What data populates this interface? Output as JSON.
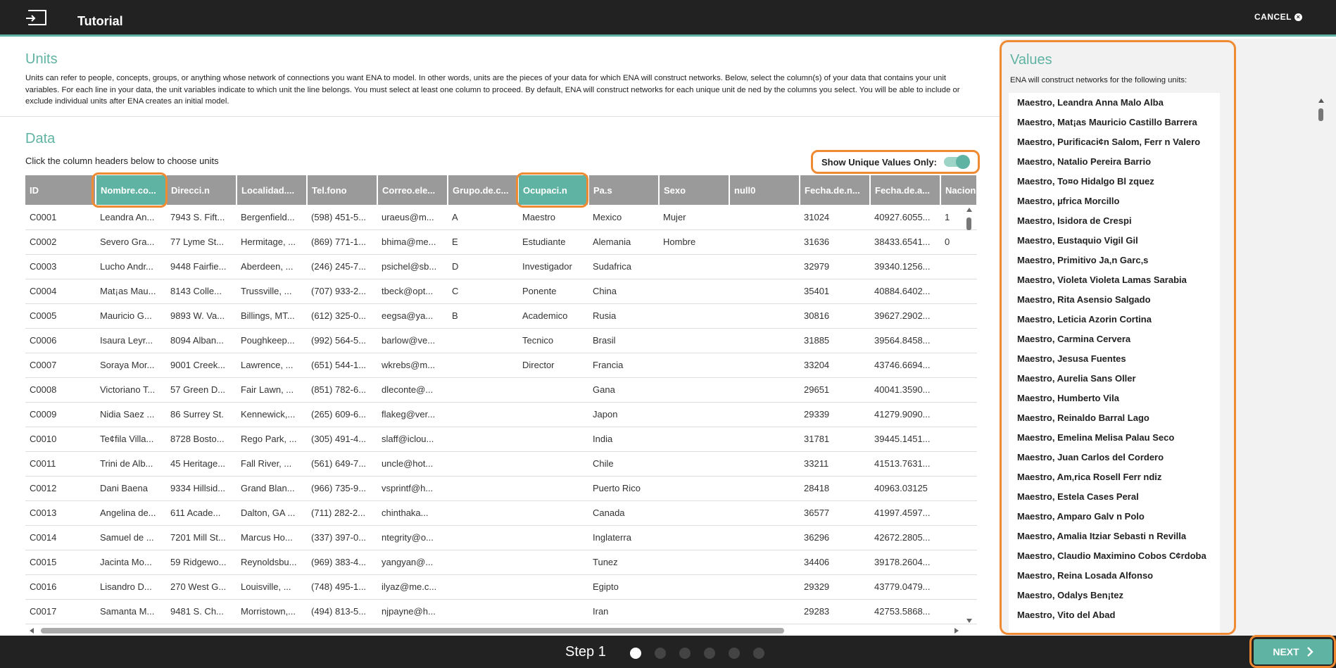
{
  "header": {
    "title": "Tutorial",
    "cancel_label": "CANCEL"
  },
  "units": {
    "title": "Units",
    "description": "Units can refer to people, concepts, groups, or anything whose network of connections you want ENA to model. In other words, units are the pieces of your data for which ENA will construct networks. Below, select the column(s) of your data that contains your unit variables. For each line in your data, the unit variables indicate to which unit the line belongs. You must select at least one column to proceed. By default, ENA will construct networks for each unique unit de ned by the columns you select. You will be able to include or exclude individual units after ENA creates an initial model."
  },
  "data": {
    "title": "Data",
    "hint": "Click the column headers below to choose units",
    "toggle_label": "Show Unique Values Only:",
    "toggle_on": true,
    "columns": [
      {
        "label": "ID",
        "selected": false
      },
      {
        "label": "Nombre.co...",
        "selected": true
      },
      {
        "label": "Direcci.n",
        "selected": false
      },
      {
        "label": "Localidad....",
        "selected": false
      },
      {
        "label": "Tel.fono",
        "selected": false
      },
      {
        "label": "Correo.ele...",
        "selected": false
      },
      {
        "label": "Grupo.de.c...",
        "selected": false
      },
      {
        "label": "Ocupaci.n",
        "selected": true
      },
      {
        "label": "Pa.s",
        "selected": false
      },
      {
        "label": "Sexo",
        "selected": false
      },
      {
        "label": "null0",
        "selected": false
      },
      {
        "label": "Fecha.de.n...",
        "selected": false
      },
      {
        "label": "Fecha.de.a...",
        "selected": false
      },
      {
        "label": "Nacion",
        "selected": false
      }
    ],
    "rows": [
      [
        "C0001",
        "Leandra An...",
        "7943 S. Fift...",
        "Bergenfield...",
        "(598) 451-5...",
        "uraeus@m...",
        "A",
        "Maestro",
        "Mexico",
        "Mujer",
        "",
        "31024",
        "40927.6055...",
        "1"
      ],
      [
        "C0002",
        "Severo Gra...",
        "77 Lyme St...",
        "Hermitage, ...",
        "(869) 771-1...",
        "bhima@me...",
        "E",
        "Estudiante",
        "Alemania",
        "Hombre",
        "",
        "31636",
        "38433.6541...",
        "0"
      ],
      [
        "C0003",
        "Lucho Andr...",
        "9448 Fairfie...",
        "Aberdeen, ...",
        "(246) 245-7...",
        "psichel@sb...",
        "D",
        "Investigador",
        "Sudafrica",
        "",
        "",
        "32979",
        "39340.1256...",
        ""
      ],
      [
        "C0004",
        "Mat¡as Mau...",
        "8143 Colle...",
        "Trussville, ...",
        "(707) 933-2...",
        "tbeck@opt...",
        "C",
        "Ponente",
        "China",
        "",
        "",
        "35401",
        "40884.6402...",
        ""
      ],
      [
        "C0005",
        "Mauricio G...",
        "9893 W. Va...",
        "Billings, MT...",
        "(612) 325-0...",
        "eegsa@ya...",
        "B",
        "Academico",
        "Rusia",
        "",
        "",
        "30816",
        "39627.2902...",
        ""
      ],
      [
        "C0006",
        "Isaura Leyr...",
        "8094 Alban...",
        "Poughkeep...",
        "(992) 564-5...",
        "barlow@ve...",
        "",
        "Tecnico",
        "Brasil",
        "",
        "",
        "31885",
        "39564.8458...",
        ""
      ],
      [
        "C0007",
        "Soraya Mor...",
        "9001 Creek...",
        "Lawrence, ...",
        "(651) 544-1...",
        "wkrebs@m...",
        "",
        "Director",
        "Francia",
        "",
        "",
        "33204",
        "43746.6694...",
        ""
      ],
      [
        "C0008",
        "Victoriano T...",
        "57 Green D...",
        "Fair Lawn, ...",
        "(851) 782-6...",
        "dleconte@...",
        "",
        "",
        "Gana",
        "",
        "",
        "29651",
        "40041.3590...",
        ""
      ],
      [
        "C0009",
        "Nidia Saez ...",
        "86 Surrey St.",
        "Kennewick,...",
        "(265) 609-6...",
        "flakeg@ver...",
        "",
        "",
        "Japon",
        "",
        "",
        "29339",
        "41279.9090...",
        ""
      ],
      [
        "C0010",
        "Te¢fila Villa...",
        "8728 Bosto...",
        "Rego Park, ...",
        "(305) 491-4...",
        "slaff@iclou...",
        "",
        "",
        "India",
        "",
        "",
        "31781",
        "39445.1451...",
        ""
      ],
      [
        "C0011",
        "Trini de Alb...",
        "45 Heritage...",
        "Fall River, ...",
        "(561) 649-7...",
        "uncle@hot...",
        "",
        "",
        "Chile",
        "",
        "",
        "33211",
        "41513.7631...",
        ""
      ],
      [
        "C0012",
        "Dani Baena",
        "9334 Hillsid...",
        "Grand Blan...",
        "(966) 735-9...",
        "vsprintf@h...",
        "",
        "",
        "Puerto Rico",
        "",
        "",
        "28418",
        "40963.03125",
        ""
      ],
      [
        "C0013",
        "Angelina de...",
        "611 Acade...",
        "Dalton, GA ...",
        "(711) 282-2...",
        "chinthaka...",
        "",
        "",
        "Canada",
        "",
        "",
        "36577",
        "41997.4597...",
        ""
      ],
      [
        "C0014",
        "Samuel de ...",
        "7201 Mill St...",
        "Marcus Ho...",
        "(337) 397-0...",
        "ntegrity@o...",
        "",
        "",
        "Inglaterra",
        "",
        "",
        "36296",
        "42672.2805...",
        ""
      ],
      [
        "C0015",
        "Jacinta Mo...",
        "59 Ridgewo...",
        "Reynoldsbu...",
        "(969) 383-4...",
        "yangyan@...",
        "",
        "",
        "Tunez",
        "",
        "",
        "34406",
        "39178.2604...",
        ""
      ],
      [
        "C0016",
        "Lisandro D...",
        "270 West G...",
        "Louisville, ...",
        "(748) 495-1...",
        "ilyaz@me.c...",
        "",
        "",
        "Egipto",
        "",
        "",
        "29329",
        "43779.0479...",
        ""
      ],
      [
        "C0017",
        "Samanta M...",
        "9481 S. Ch...",
        "Morristown,...",
        "(494) 813-5...",
        "njpayne@h...",
        "",
        "",
        "Iran",
        "",
        "",
        "29283",
        "42753.5868...",
        ""
      ]
    ]
  },
  "values": {
    "title": "Values",
    "description": "ENA will construct networks for the following units:",
    "items": [
      "Maestro, Leandra Anna Malo Alba",
      "Maestro, Mat¡as Mauricio Castillo Barrera",
      "Maestro, Purificaci¢n Salom, Ferr n Valero",
      "Maestro, Natalio Pereira Barrio",
      "Maestro, To¤o Hidalgo Bl zquez",
      "Maestro, µfrica Morcillo",
      "Maestro, Isidora de Crespi",
      "Maestro, Eustaquio Vigil Gil",
      "Maestro, Primitivo Ja‚n Garc‚s",
      "Maestro, Violeta Violeta Lamas Sarabia",
      "Maestro, Rita Asensio Salgado",
      "Maestro, Leticia Azorin Cortina",
      "Maestro, Carmina Cervera",
      "Maestro, Jesusa Fuentes",
      "Maestro, Aurelia Sans Oller",
      "Maestro, Humberto Vila",
      "Maestro, Reinaldo Barral Lago",
      "Maestro, Emelina Melisa Palau Seco",
      "Maestro, Juan Carlos del Cordero",
      "Maestro, Am‚rica Rosell Ferr ndiz",
      "Maestro, Estela Cases Peral",
      "Maestro, Amparo Galv n Polo",
      "Maestro, Amalia Itziar Sebasti n Revilla",
      "Maestro, Claudio Maximino Cobos C¢rdoba",
      "Maestro, Reina Losada Alfonso",
      "Maestro, Odalys Ben¡tez",
      "Maestro, Vito del Abad"
    ]
  },
  "footer": {
    "step_label": "Step 1",
    "total_steps": 6,
    "current_step": 1,
    "next_label": "NEXT"
  },
  "colors": {
    "accent": "#5fb3a2",
    "highlight": "#f08a32",
    "bar": "#222222",
    "header_gray": "#9a9a9a"
  }
}
